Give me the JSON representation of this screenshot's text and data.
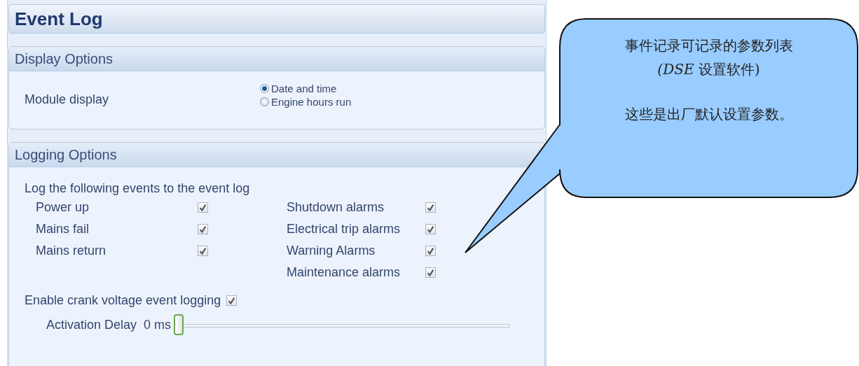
{
  "title": "Event Log",
  "display_options": {
    "title": "Display Options",
    "label": "Module display",
    "options": [
      {
        "label": "Date and time",
        "selected": true
      },
      {
        "label": "Engine hours run",
        "selected": false
      }
    ]
  },
  "logging_options": {
    "title": "Logging Options",
    "intro": "Log the following events to the event log",
    "columns": [
      [
        {
          "label": "Power up",
          "checked": true
        },
        {
          "label": "Mains fail",
          "checked": true
        },
        {
          "label": "Mains return",
          "checked": true
        }
      ],
      [
        {
          "label": "Shutdown alarms",
          "checked": true
        },
        {
          "label": "Electrical trip alarms",
          "checked": true
        },
        {
          "label": "Warning Alarms",
          "checked": true
        },
        {
          "label": "Maintenance alarms",
          "checked": true
        }
      ]
    ],
    "crank": {
      "label": "Enable crank voltage event logging",
      "checked": true
    },
    "activation_delay": {
      "label": "Activation Delay",
      "reading": "0 ms",
      "level": 0
    }
  },
  "callout": {
    "lines": [
      "事件记录可记录的参数列表",
      "*(DSE* 设置软件)",
      "这些是出厂默认设置参数。"
    ]
  }
}
